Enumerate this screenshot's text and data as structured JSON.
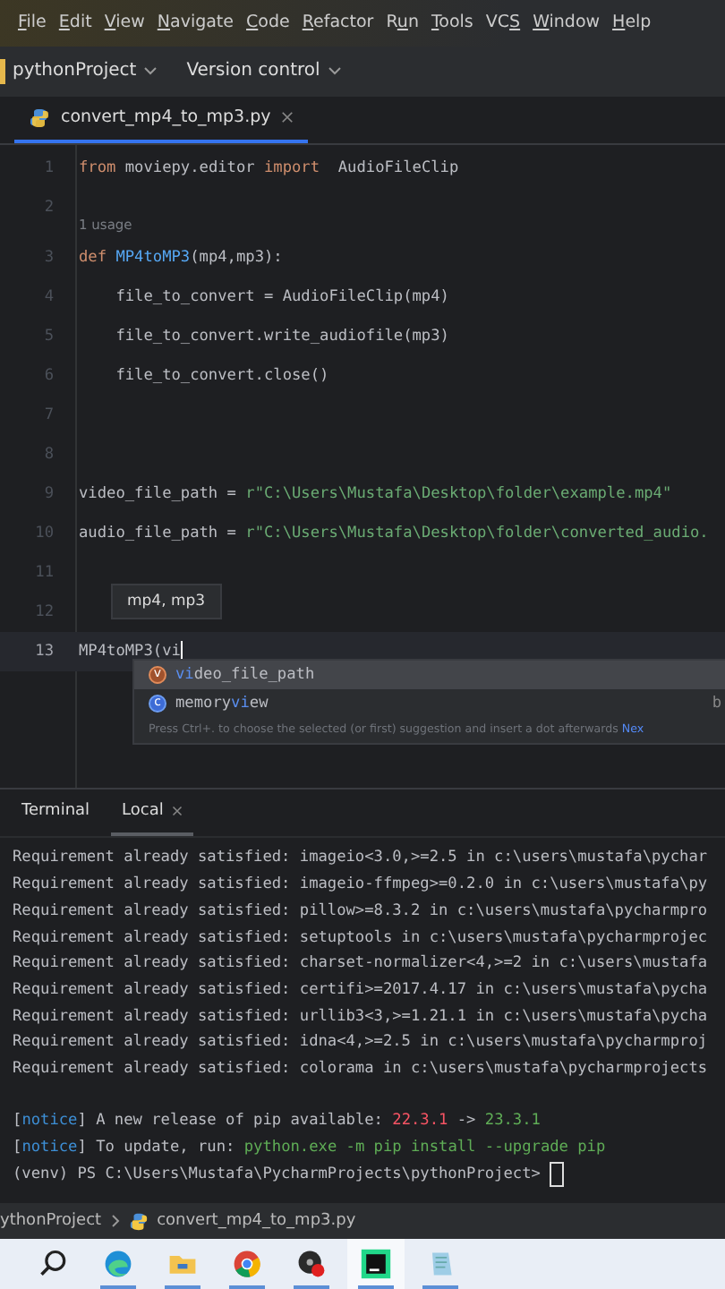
{
  "menu": [
    {
      "key": "F",
      "post": "ile"
    },
    {
      "key": "E",
      "post": "dit"
    },
    {
      "key": "V",
      "post": "iew"
    },
    {
      "key": "N",
      "post": "avigate"
    },
    {
      "key": "C",
      "post": "ode"
    },
    {
      "key": "R",
      "post": "efactor"
    },
    {
      "pre": "R",
      "key": "u",
      "post": "n"
    },
    {
      "key": "T",
      "post": "ools"
    },
    {
      "pre": "VC",
      "key": "S"
    },
    {
      "key": "W",
      "post": "indow"
    },
    {
      "key": "H",
      "post": "elp"
    }
  ],
  "toolbar": {
    "project": "pythonProject",
    "vcs": "Version control"
  },
  "editor_tabs": [
    {
      "label": "convert_mp4_to_mp3.py",
      "selected": true
    }
  ],
  "editor": {
    "lines": [
      {
        "kind": "code",
        "number": "1",
        "tokens": [
          {
            "t": "from ",
            "kind": "keyword"
          },
          {
            "t": "moviepy.editor ",
            "kind": "plain"
          },
          {
            "t": "import ",
            "kind": "keyword"
          },
          {
            "t": " AudioFileClip",
            "kind": "plain"
          }
        ]
      },
      {
        "kind": "code",
        "number": "2"
      },
      {
        "kind": "inlay",
        "text": "1 usage"
      },
      {
        "kind": "code",
        "number": "3",
        "tokens": [
          {
            "t": "def ",
            "kind": "keyword"
          },
          {
            "t": "MP4toMP3",
            "kind": "function"
          },
          {
            "t": "(mp4,mp3):",
            "kind": "plain"
          }
        ]
      },
      {
        "kind": "code",
        "number": "4",
        "tokens": [
          {
            "t": "    file_to_convert = AudioFileClip(mp4)",
            "kind": "plain"
          }
        ]
      },
      {
        "kind": "code",
        "number": "5",
        "tokens": [
          {
            "t": "    file_to_convert.write_audiofile(mp3)",
            "kind": "plain"
          }
        ]
      },
      {
        "kind": "code",
        "number": "6",
        "tokens": [
          {
            "t": "    file_to_convert.close()",
            "kind": "plain"
          }
        ]
      },
      {
        "kind": "code",
        "number": "7"
      },
      {
        "kind": "code",
        "number": "8"
      },
      {
        "kind": "code",
        "number": "9",
        "tokens": [
          {
            "t": "video_file_path = ",
            "kind": "plain"
          },
          {
            "t": "r\"C:\\Users\\Mustafa\\Desktop\\folder\\example.mp4\"",
            "kind": "string"
          }
        ]
      },
      {
        "kind": "code",
        "number": "10",
        "tokens": [
          {
            "t": "audio_file_path = ",
            "kind": "plain"
          },
          {
            "t": "r\"C:\\Users\\Mustafa\\Desktop\\folder\\converted_audio.",
            "kind": "string"
          }
        ]
      },
      {
        "kind": "code",
        "number": "11"
      },
      {
        "kind": "code",
        "number": "12"
      },
      {
        "kind": "code",
        "number": "13",
        "current": true,
        "tokens": [
          {
            "t": "MP4toMP3(vi",
            "kind": "plain"
          }
        ]
      }
    ],
    "param_hint": "mp4, mp3",
    "completion": {
      "items": [
        {
          "icon": "v",
          "kind": "variable",
          "match": "vi",
          "rest": "deo_file_path",
          "selected": true
        },
        {
          "icon": "c",
          "kind": "class",
          "prefix": "memory",
          "match": "vi",
          "rest": "ew",
          "extra": "b",
          "selected": false
        }
      ],
      "footer": "Press Ctrl+. to choose the selected (or first) suggestion and insert a dot afterwards",
      "footer_link": "Nex"
    }
  },
  "terminal": {
    "tabs": [
      {
        "label": "Terminal",
        "selected": false,
        "closable": false
      },
      {
        "label": "Local",
        "selected": true,
        "closable": true
      }
    ],
    "lines": [
      {
        "kind": "text",
        "tokens": [
          {
            "t": "Requirement already satisfied: imageio<3.0,>=2.5 in c:\\users\\mustafa\\pychar",
            "kind": "plain"
          }
        ]
      },
      {
        "kind": "text",
        "tokens": [
          {
            "t": "Requirement already satisfied: imageio-ffmpeg>=0.2.0 in c:\\users\\mustafa\\py",
            "kind": "plain"
          }
        ]
      },
      {
        "kind": "text",
        "tokens": [
          {
            "t": "Requirement already satisfied: pillow>=8.3.2 in c:\\users\\mustafa\\pycharmpro",
            "kind": "plain"
          }
        ]
      },
      {
        "kind": "text",
        "tokens": [
          {
            "t": "Requirement already satisfied: setuptools in c:\\users\\mustafa\\pycharmprojec",
            "kind": "plain"
          }
        ]
      },
      {
        "kind": "text",
        "tokens": [
          {
            "t": "Requirement already satisfied: charset-normalizer<4,>=2 in c:\\users\\mustafa",
            "kind": "plain"
          }
        ]
      },
      {
        "kind": "text",
        "tokens": [
          {
            "t": "Requirement already satisfied: certifi>=2017.4.17 in c:\\users\\mustafa\\pycha",
            "kind": "plain"
          }
        ]
      },
      {
        "kind": "text",
        "tokens": [
          {
            "t": "Requirement already satisfied: urllib3<3,>=1.21.1 in c:\\users\\mustafa\\pycha",
            "kind": "plain"
          }
        ]
      },
      {
        "kind": "text",
        "tokens": [
          {
            "t": "Requirement already satisfied: idna<4,>=2.5 in c:\\users\\mustafa\\pycharmproj",
            "kind": "plain"
          }
        ]
      },
      {
        "kind": "text",
        "tokens": [
          {
            "t": "Requirement already satisfied: colorama in c:\\users\\mustafa\\pycharmprojects",
            "kind": "plain"
          }
        ]
      },
      {
        "kind": "blank"
      },
      {
        "kind": "text",
        "tokens": [
          {
            "t": "[",
            "kind": "plain"
          },
          {
            "t": "notice",
            "kind": "info"
          },
          {
            "t": "] A new release of pip available: ",
            "kind": "plain"
          },
          {
            "t": "22.3.1",
            "kind": "error"
          },
          {
            "t": " -> ",
            "kind": "plain"
          },
          {
            "t": "23.3.1",
            "kind": "success"
          }
        ]
      },
      {
        "kind": "text",
        "tokens": [
          {
            "t": "[",
            "kind": "plain"
          },
          {
            "t": "notice",
            "kind": "info"
          },
          {
            "t": "] To update, run: ",
            "kind": "plain"
          },
          {
            "t": "python.exe -m pip install --upgrade pip",
            "kind": "success"
          }
        ]
      },
      {
        "kind": "prompt",
        "tokens": [
          {
            "t": "(venv) PS C:\\Users\\Mustafa\\PycharmProjects\\pythonProject> ",
            "kind": "plain"
          }
        ]
      }
    ]
  },
  "breadcrumb": [
    "ythonProject",
    "convert_mp4_to_mp3.py"
  ],
  "taskbar": [
    {
      "kind": "search"
    },
    {
      "kind": "edge",
      "active": true
    },
    {
      "kind": "folder",
      "active": true
    },
    {
      "kind": "chrome",
      "active": true
    },
    {
      "kind": "recorder",
      "active": true
    },
    {
      "kind": "pycharm",
      "active": true
    },
    {
      "kind": "notepad",
      "active": true
    }
  ]
}
